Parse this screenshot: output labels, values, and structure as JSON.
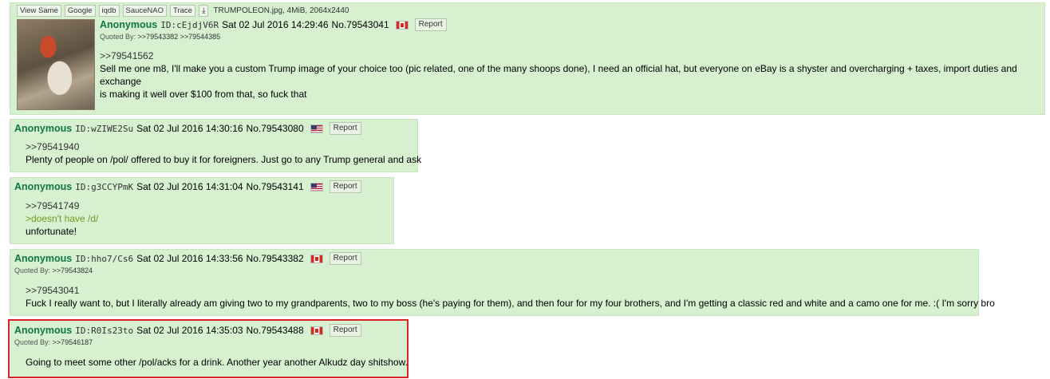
{
  "toolbar": {
    "buttons": [
      "View Same",
      "Google",
      "iqdb",
      "SauceNAO",
      "Trace"
    ],
    "download_icon": "download-icon",
    "file_info": "TRUMPOLEON.jpg, 4MiB, 2064x2440"
  },
  "posts": [
    {
      "name": "Anonymous",
      "id": "ID:cEjdjV6R",
      "datetime": "Sat 02 Jul 2016 14:29:46",
      "no": "No.79543041",
      "flag": "ca",
      "report": "Report",
      "quoted_by_label": "Quoted By:",
      "quoted_by": ">>79543382 >>79544385",
      "reply_link": ">>79541562",
      "lines": [
        "Sell me one m8, I'll make you a custom Trump image of your choice too (pic related, one of the many shoops done), I need an official hat, but everyone on eBay is a shyster and overcharging + taxes, import duties and exchange",
        "is making it well over $100 from that, so fuck that"
      ]
    },
    {
      "name": "Anonymous",
      "id": "ID:wZIWE2Su",
      "datetime": "Sat 02 Jul 2016 14:30:16",
      "no": "No.79543080",
      "flag": "us",
      "report": "Report",
      "reply_link": ">>79541940",
      "lines": [
        "Plenty of people on /pol/ offered to buy it for foreigners. Just go to any Trump general and ask"
      ]
    },
    {
      "name": "Anonymous",
      "id": "ID:g3CCYPmK",
      "datetime": "Sat 02 Jul 2016 14:31:04",
      "no": "No.79543141",
      "flag": "us",
      "report": "Report",
      "reply_link": ">>79541749",
      "greentext": ">doesn't have /d/",
      "lines": [
        "unfortunate!"
      ]
    },
    {
      "name": "Anonymous",
      "id": "ID:hho7/Cs6",
      "datetime": "Sat 02 Jul 2016 14:33:56",
      "no": "No.79543382",
      "flag": "ca",
      "report": "Report",
      "quoted_by_label": "Quoted By:",
      "quoted_by": ">>79543824",
      "reply_link": ">>79543041",
      "lines": [
        "Fuck I really want to, but I literally already am giving two to my grandparents, two to my boss (he's paying for them), and then four for my four brothers, and I'm getting a classic red and white and a camo one for me. :( I'm sorry bro"
      ]
    },
    {
      "name": "Anonymous",
      "id": "ID:R0Is23to",
      "datetime": "Sat 02 Jul 2016 14:35:03",
      "no": "No.79543488",
      "flag": "ca",
      "report": "Report",
      "quoted_by_label": "Quoted By:",
      "quoted_by": ">>79546187",
      "lines": [
        "Going to meet some other /pol/acks for a drink. Another year another Alkudz day shitshow."
      ]
    }
  ],
  "colors": {
    "post_bg": "#d6f0d0",
    "name": "#117743",
    "greentext": "#789922",
    "highlight_border": "#d9222a"
  }
}
